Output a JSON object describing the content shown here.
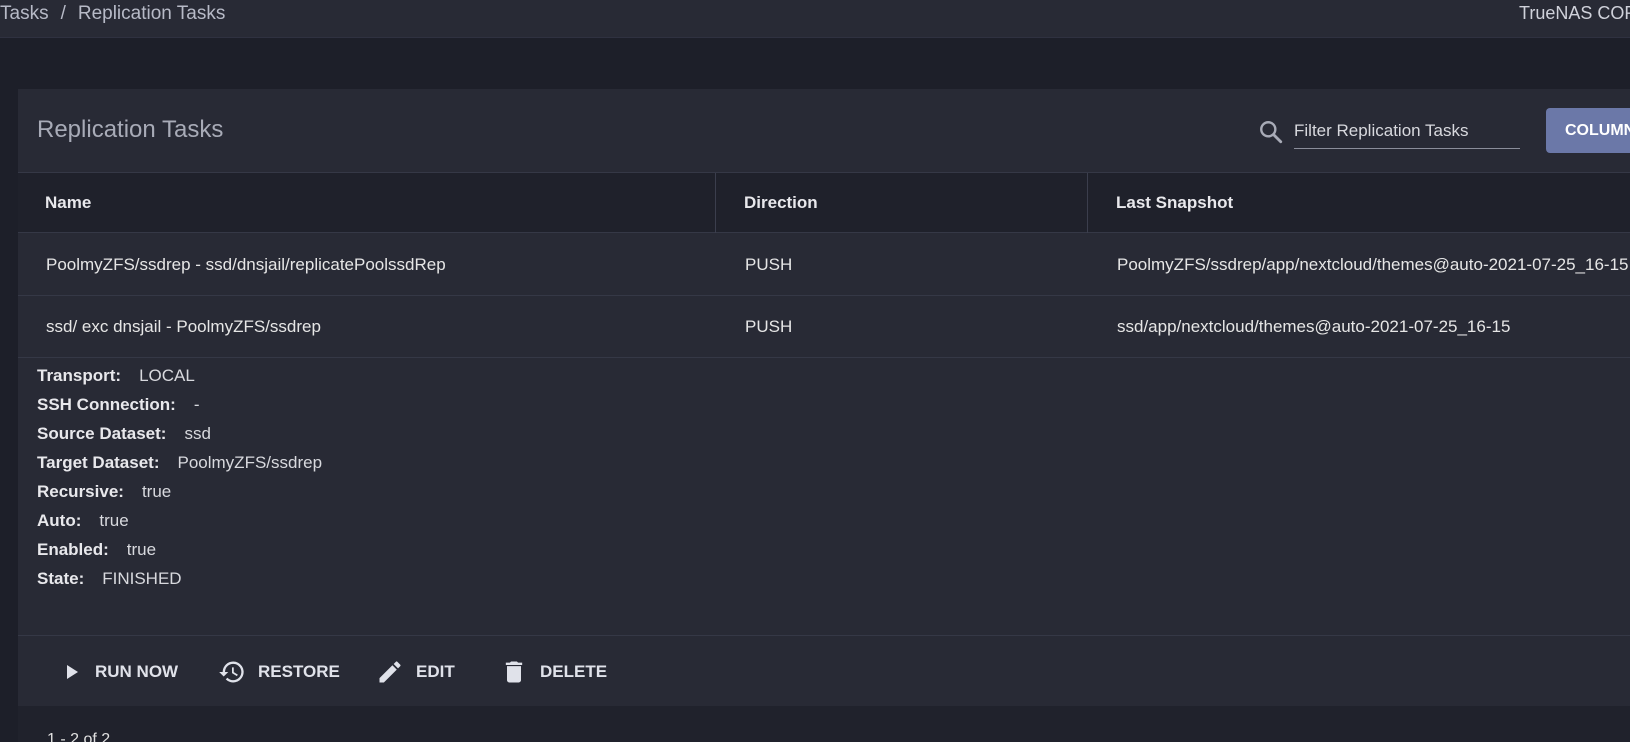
{
  "breadcrumb": {
    "parent": "Tasks",
    "separator": "/",
    "current": "Replication Tasks"
  },
  "brand": "TrueNAS CORE",
  "card": {
    "title": "Replication Tasks",
    "search_placeholder": "Filter Replication Tasks",
    "columns_label": "COLUMNS"
  },
  "table": {
    "headers": [
      "Name",
      "Direction",
      "Last Snapshot"
    ],
    "rows": [
      {
        "name": "PoolmyZFS/ssdrep - ssd/dnsjail/replicatePoolssdRep",
        "direction": "PUSH",
        "last_snapshot": "PoolmyZFS/ssdrep/app/nextcloud/themes@auto-2021-07-25_16-15"
      },
      {
        "name": "ssd/ exc dnsjail - PoolmyZFS/ssdrep",
        "direction": "PUSH",
        "last_snapshot": "ssd/app/nextcloud/themes@auto-2021-07-25_16-15"
      }
    ]
  },
  "details": [
    {
      "label": "Transport:",
      "value": "LOCAL"
    },
    {
      "label": "SSH Connection:",
      "value": "-"
    },
    {
      "label": "Source Dataset:",
      "value": "ssd"
    },
    {
      "label": "Target Dataset:",
      "value": "PoolmyZFS/ssdrep"
    },
    {
      "label": "Recursive:",
      "value": "true"
    },
    {
      "label": "Auto:",
      "value": "true"
    },
    {
      "label": "Enabled:",
      "value": "true"
    },
    {
      "label": "State:",
      "value": "FINISHED"
    }
  ],
  "actions": {
    "run_now": "RUN NOW",
    "restore": "RESTORE",
    "edit": "EDIT",
    "delete": "DELETE"
  },
  "paginator": "1 - 2 of 2",
  "icons": {
    "search": "search-icon",
    "run": "play-icon",
    "restore": "history-icon",
    "edit": "pencil-icon",
    "delete": "trash-icon"
  },
  "colors": {
    "background": "#1d1f29",
    "card": "#282a35",
    "accent": "#6b78a8"
  }
}
